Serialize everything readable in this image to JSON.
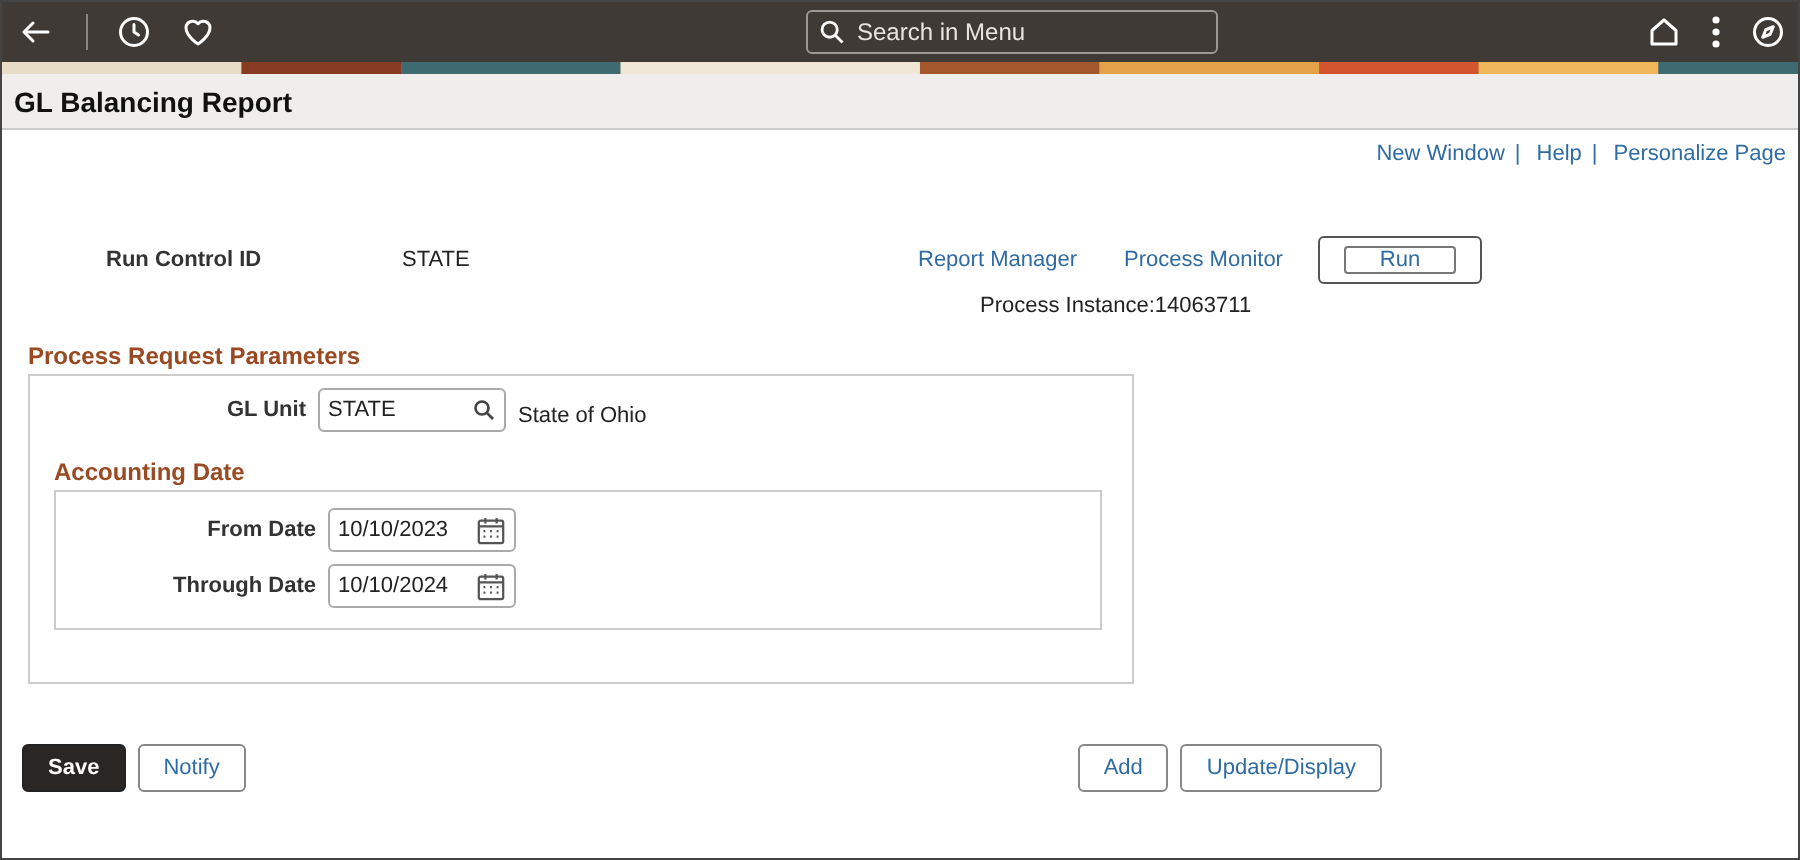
{
  "top_bar": {
    "search": {
      "placeholder": "Search in Menu"
    }
  },
  "page_title": "GL Balancing Report",
  "header_links": [
    {
      "label": "New Window",
      "separator": "|"
    },
    {
      "label": "Help",
      "separator": "|"
    },
    {
      "label": "Personalize Page"
    }
  ],
  "run_control": {
    "label": "Run Control ID",
    "value": "STATE",
    "links": [
      "Report Manager",
      "Process Monitor"
    ],
    "run_button": "Run",
    "process_instance": "Process Instance:14063711"
  },
  "parameters": {
    "title": "Process Request Parameters",
    "gl_unit": {
      "label": "GL Unit",
      "value": "STATE",
      "description": "State of Ohio"
    },
    "accounting_date": {
      "title": "Accounting Date",
      "fields": [
        {
          "label": "From Date",
          "value": "10/10/2023"
        },
        {
          "label": "Through Date",
          "value": "10/10/2024"
        }
      ]
    }
  },
  "buttons_left": [
    {
      "label": "Save",
      "kind": "primary"
    },
    {
      "label": "Notify",
      "kind": "secondary"
    }
  ],
  "buttons_right": [
    {
      "label": "Add",
      "kind": "secondary"
    },
    {
      "label": "Update/Display",
      "kind": "secondary"
    }
  ]
}
